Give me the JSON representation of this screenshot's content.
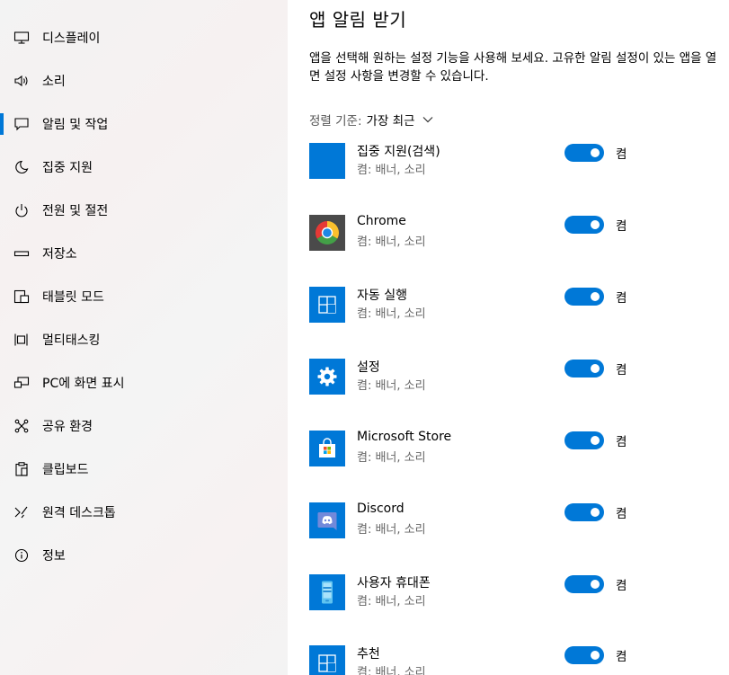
{
  "sidebar": {
    "items": [
      {
        "label": "디스플레이",
        "icon": "monitor-icon"
      },
      {
        "label": "소리",
        "icon": "speaker-icon"
      },
      {
        "label": "알림 및 작업",
        "icon": "message-icon",
        "active": true
      },
      {
        "label": "집중 지원",
        "icon": "moon-icon"
      },
      {
        "label": "전원 및 절전",
        "icon": "power-icon"
      },
      {
        "label": "저장소",
        "icon": "storage-icon"
      },
      {
        "label": "태블릿 모드",
        "icon": "tablet-icon"
      },
      {
        "label": "멀티태스킹",
        "icon": "multitasking-icon"
      },
      {
        "label": "PC에 화면 표시",
        "icon": "project-icon"
      },
      {
        "label": "공유 환경",
        "icon": "share-icon"
      },
      {
        "label": "클립보드",
        "icon": "clipboard-icon"
      },
      {
        "label": "원격 데스크톱",
        "icon": "remote-desktop-icon"
      },
      {
        "label": "정보",
        "icon": "info-icon"
      }
    ]
  },
  "main": {
    "title": "앱 알림 받기",
    "description": "앱을 선택해 원하는 설정 기능을 사용해 보세요. 고유한 알림 설정이 있는 앱을 열면 설정 사항을 변경할 수 있습니다.",
    "sort_label": "정렬 기준:",
    "sort_value": "가장 최근",
    "apps": [
      {
        "name": "집중 지원(검색)",
        "sub": "켬: 배너, 소리",
        "toggle": "켬",
        "on": true,
        "icon": "focus-assist-app-icon"
      },
      {
        "name": "Chrome",
        "sub": "켬: 배너, 소리",
        "toggle": "켬",
        "on": true,
        "icon": "chrome-icon"
      },
      {
        "name": "자동 실행",
        "sub": "켬: 배너, 소리",
        "toggle": "켬",
        "on": true,
        "icon": "autoplay-icon"
      },
      {
        "name": "설정",
        "sub": "켬: 배너, 소리",
        "toggle": "켬",
        "on": true,
        "icon": "settings-gear-icon"
      },
      {
        "name": "Microsoft Store",
        "sub": "켬: 배너, 소리",
        "toggle": "켬",
        "on": true,
        "icon": "store-icon"
      },
      {
        "name": "Discord",
        "sub": "켬: 배너, 소리",
        "toggle": "켬",
        "on": true,
        "icon": "discord-icon"
      },
      {
        "name": "사용자 휴대폰",
        "sub": "켬: 배너, 소리",
        "toggle": "켬",
        "on": true,
        "icon": "phone-icon"
      },
      {
        "name": "추천",
        "sub": "켬: 배너, 소리",
        "toggle": "켬",
        "on": true,
        "icon": "suggested-icon"
      }
    ]
  },
  "colors": {
    "accent": "#0078d7",
    "chrome_bg": "#4a4a4a"
  }
}
